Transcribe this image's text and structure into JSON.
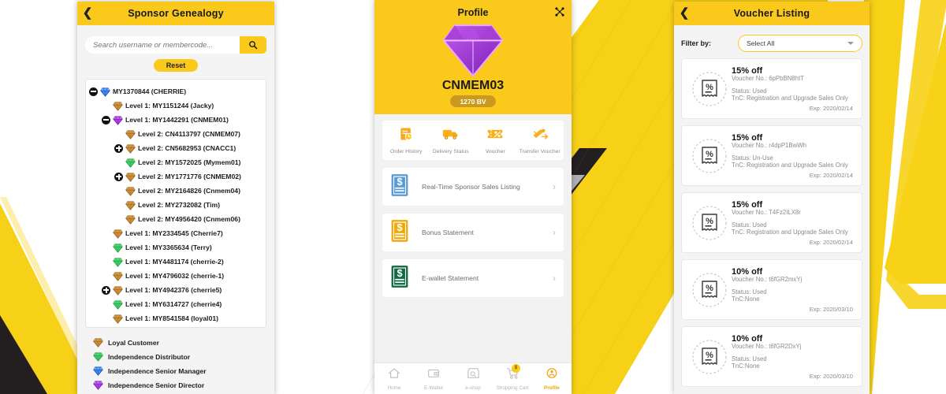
{
  "colors": {
    "brand_yellow": "#fbc91c",
    "black": "#1a1a1a",
    "muted_text": "#8b8b8b",
    "accent_orange": "#f0a30a"
  },
  "panel1": {
    "appbar": {
      "back_icon": "chevron-left-icon",
      "title": "Sponsor Genealogy"
    },
    "search": {
      "placeholder": "Search username or membercode...",
      "value": "",
      "button_icon": "search-icon"
    },
    "reset_label": "Reset",
    "tree": [
      {
        "indent": 0,
        "toggle": "minus",
        "gem": "blue",
        "label": "MY1370844 (CHERRIE)"
      },
      {
        "indent": 1,
        "toggle": "none",
        "gem": "bronze",
        "label": "Level 1: MY1151244 (Jacky)"
      },
      {
        "indent": 1,
        "toggle": "minus",
        "gem": "purple",
        "label": "Level 1: MY1442291 (CNMEM01)"
      },
      {
        "indent": 2,
        "toggle": "none",
        "gem": "bronze",
        "label": "Level 2: CN4113797 (CNMEM07)"
      },
      {
        "indent": 2,
        "toggle": "plus",
        "gem": "bronze",
        "label": "Level 2: CN5682953 (CNACC1)"
      },
      {
        "indent": 2,
        "toggle": "none",
        "gem": "green",
        "label": "Level 2: MY1572025 (Mymem01)"
      },
      {
        "indent": 2,
        "toggle": "plus",
        "gem": "bronze",
        "label": "Level 2: MY1771776 (CNMEM02)"
      },
      {
        "indent": 2,
        "toggle": "none",
        "gem": "bronze",
        "label": "Level 2: MY2164826 (Cnmem04)"
      },
      {
        "indent": 2,
        "toggle": "none",
        "gem": "bronze",
        "label": "Level 2: MY2732082 (Tim)"
      },
      {
        "indent": 2,
        "toggle": "none",
        "gem": "bronze",
        "label": "Level 2: MY4956420 (Cnmem06)"
      },
      {
        "indent": 1,
        "toggle": "none",
        "gem": "bronze",
        "label": "Level 1: MY2334545 (Cherrie7)"
      },
      {
        "indent": 1,
        "toggle": "none",
        "gem": "green",
        "label": "Level 1: MY3365634 (Terry)"
      },
      {
        "indent": 1,
        "toggle": "none",
        "gem": "green",
        "label": "Level 1: MY4481174 (cherrie-2)"
      },
      {
        "indent": 1,
        "toggle": "none",
        "gem": "bronze",
        "label": "Level 1: MY4796032 (cherrie-1)"
      },
      {
        "indent": 1,
        "toggle": "plus",
        "gem": "bronze",
        "label": "Level 1: MY4942376 (cherrie5)"
      },
      {
        "indent": 1,
        "toggle": "none",
        "gem": "green",
        "label": "Level 1: MY6314727 (cherrie4)"
      },
      {
        "indent": 1,
        "toggle": "none",
        "gem": "bronze",
        "label": "Level 1: MY8541584 (loyal01)"
      }
    ],
    "legend": [
      {
        "gem": "bronze",
        "label": "Loyal Customer"
      },
      {
        "gem": "green",
        "label": "Independence Distributor"
      },
      {
        "gem": "blue",
        "label": "Independence Senior Manager"
      },
      {
        "gem": "purple",
        "label": "Independence Senior Director"
      }
    ]
  },
  "panel2": {
    "appbar": {
      "title": "Profile",
      "share_icon": "share-nodes-icon"
    },
    "hero": {
      "gem": "purple",
      "member_code": "CNMEM03",
      "bv_label": "1270 BV"
    },
    "quick_actions": [
      {
        "icon": "order-history-icon",
        "label": "Order History"
      },
      {
        "icon": "delivery-truck-icon",
        "label": "Delivery Status"
      },
      {
        "icon": "voucher-icon",
        "label": "Voucher"
      },
      {
        "icon": "transfer-voucher-icon",
        "label": "Transfer Voucher"
      }
    ],
    "menu_items": [
      {
        "icon": "document-blue-icon",
        "label": "Real-Time Sponsor Sales Listing",
        "chevron": "chevron-right-icon"
      },
      {
        "icon": "document-yellow-icon",
        "label": "Bonus Statement",
        "chevron": "chevron-right-icon"
      },
      {
        "icon": "document-green-icon",
        "label": "E-wallet Statement",
        "chevron": "chevron-right-icon"
      }
    ],
    "tabs": [
      {
        "icon": "home-icon",
        "label": "Home",
        "active": false,
        "badge": ""
      },
      {
        "icon": "wallet-icon",
        "label": "E-Wallet",
        "active": false,
        "badge": ""
      },
      {
        "icon": "eshop-icon",
        "label": "e-shop",
        "active": false,
        "badge": ""
      },
      {
        "icon": "shopping-cart-icon",
        "label": "Shopping Cart",
        "active": false,
        "badge": "$"
      },
      {
        "icon": "profile-icon",
        "label": "Profile",
        "active": true,
        "badge": ""
      }
    ]
  },
  "panel3": {
    "appbar": {
      "back_icon": "chevron-left-icon",
      "title": "Voucher Listing"
    },
    "filter": {
      "label": "Filter by:",
      "selected": "Select All",
      "caret": "chevron-down-icon"
    },
    "vouchers": [
      {
        "icon": "percent-voucher-icon",
        "discount": "15% off",
        "voucher_no": "Voucher No.: 6pPbBN8htT",
        "status": "Status: Used",
        "tnc": "TnC: Registration and Upgrade Sales Only",
        "exp": "Exp: 2020/02/14"
      },
      {
        "icon": "percent-voucher-icon",
        "discount": "15% off",
        "voucher_no": "Voucher No.: r4dpP1BwWh",
        "status": "Status: Un-Use",
        "tnc": "TnC: Registration and Upgrade Sales Only",
        "exp": "Exp: 2020/02/14"
      },
      {
        "icon": "percent-voucher-icon",
        "discount": "15% off",
        "voucher_no": "Voucher No.: T4Fz2ILX8r",
        "status": "Status: Used",
        "tnc": "TnC: Registration and Upgrade Sales Only",
        "exp": "Exp: 2020/02/14"
      },
      {
        "icon": "percent-voucher-icon",
        "discount": "10% off",
        "voucher_no": "Voucher No.: t6fGR2mxYj",
        "status": "Status: Used",
        "tnc": "TnC:None",
        "exp": "Exp: 2020/03/10"
      },
      {
        "icon": "percent-voucher-icon",
        "discount": "10% off",
        "voucher_no": "Voucher No.: t6fGR2DxYj",
        "status": "Status: Used",
        "tnc": "TnC:None",
        "exp": "Exp: 2020/03/10"
      }
    ]
  }
}
